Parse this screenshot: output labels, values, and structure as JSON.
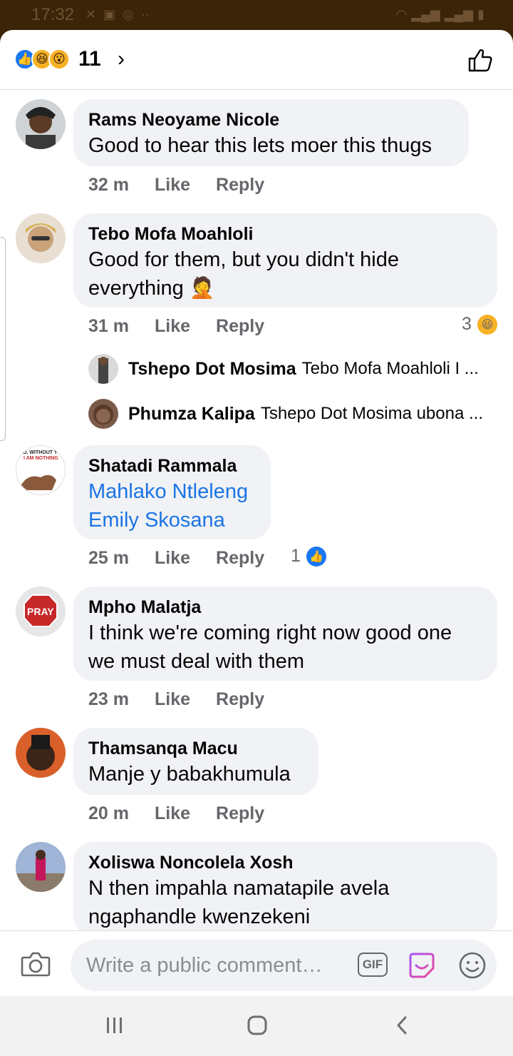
{
  "status_bar": {
    "time": "17:32"
  },
  "header": {
    "reaction_count": "11"
  },
  "composer": {
    "placeholder": "Write a public comment…",
    "gif_label": "GIF"
  },
  "comments": [
    {
      "author": "Rams Neoyame Nicole",
      "text": "Good to hear this lets moer this thugs",
      "time": "32 m",
      "like": "Like",
      "reply": "Reply"
    },
    {
      "author": "Tebo Mofa Moahloli",
      "text_line1": "Good for them, but you didn't hide",
      "text_line2": "everything",
      "emoji": "🤦",
      "time": "31 m",
      "like": "Like",
      "reply": "Reply",
      "reaction_count": "3",
      "replies": [
        {
          "author": "Tshepo Dot Mosima",
          "text": "Tebo Mofa Moahloli I ..."
        },
        {
          "author": "Phumza Kalipa",
          "text": "Tshepo Dot Mosima ubona ..."
        }
      ]
    },
    {
      "author": "Shatadi Rammala",
      "mention1": "Mahlako Ntleleng",
      "mention2": "Emily Skosana",
      "time": "25 m",
      "like": "Like",
      "reply": "Reply",
      "reaction_count": "1",
      "avatar_text1": "OD. WITHOUT YOU",
      "avatar_text2": "I AM NOTHING"
    },
    {
      "author": "Mpho Malatja",
      "text_line1": "I think we're coming right now good one",
      "text_line2": "we must deal with them",
      "time": "23 m",
      "like": "Like",
      "reply": "Reply",
      "avatar_text": "PRAY"
    },
    {
      "author": "Thamsanqa Macu",
      "text": "Manje y babakhumula",
      "time": "20 m",
      "like": "Like",
      "reply": "Reply"
    },
    {
      "author": "Xoliswa Noncolela Xosh",
      "text_line1": "N then impahla namatapile avela",
      "text_line2": "ngaphandle kwenzekeni"
    }
  ],
  "colors": {
    "accent": "#1877f2",
    "link": "#1b74e4",
    "bubble": "#f0f2f5",
    "meta": "#65676b"
  }
}
